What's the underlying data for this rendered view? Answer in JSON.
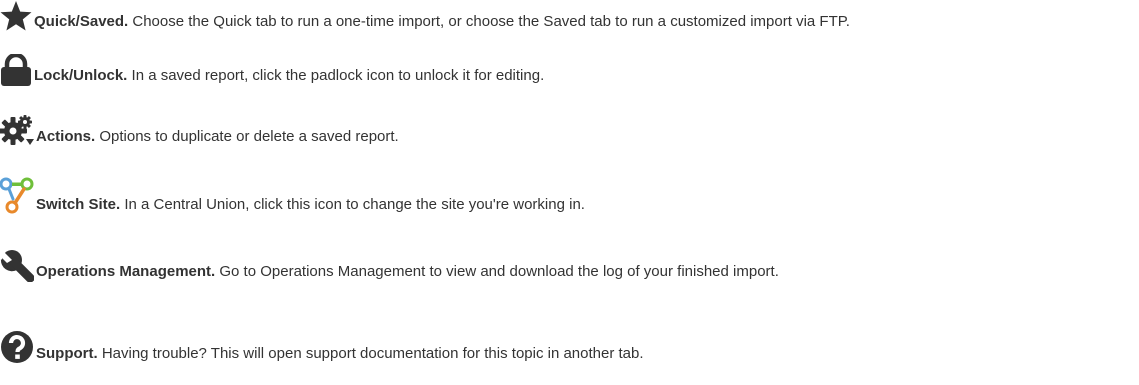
{
  "items": [
    {
      "icon": "star-icon",
      "term": "Quick/Saved.",
      "desc": " Choose the Quick tab to run a one-time import, or choose the Saved tab to run a customized import via FTP."
    },
    {
      "icon": "padlock-icon",
      "term": "Lock/Unlock.",
      "desc": " In a saved report, click the padlock icon to unlock it for editing."
    },
    {
      "icon": "gears-icon",
      "term": "Actions.",
      "desc": " Options to duplicate or delete a saved report."
    },
    {
      "icon": "switch-site-icon",
      "term": "Switch Site.",
      "desc": " In a Central Union, click this icon to change the site you're working in."
    },
    {
      "icon": "wrench-icon",
      "term": "Operations Management.",
      "desc": " Go to Operations Management to view and download the log of your finished import."
    },
    {
      "icon": "question-icon",
      "term": "Support.",
      "desc": " Having trouble? This will open support documentation for this topic in another tab."
    }
  ],
  "colors": {
    "text": "#333333",
    "icon": "#333333",
    "switch_blue": "#5aa0d8",
    "switch_green": "#6fbf3a",
    "switch_orange": "#e8892b"
  }
}
